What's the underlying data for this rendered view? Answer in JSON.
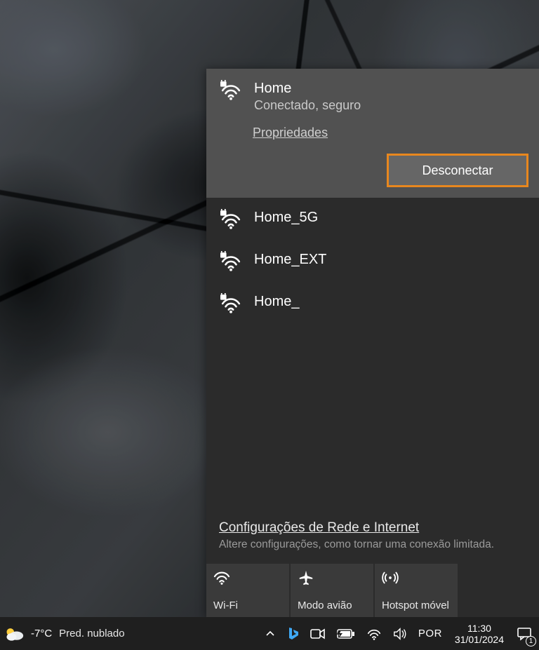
{
  "flyout": {
    "connected": {
      "ssid": "Home",
      "status": "Conectado, seguro",
      "properties_label": "Propriedades",
      "disconnect_label": "Desconectar"
    },
    "networks": [
      {
        "ssid": "Home_5G"
      },
      {
        "ssid": "Home_EXT"
      },
      {
        "ssid": "Home_"
      }
    ],
    "settings_link": {
      "title": "Configurações de Rede e Internet",
      "subtitle": "Altere configurações, como tornar uma conexão limitada."
    },
    "tiles": {
      "wifi": "Wi-Fi",
      "airplane": "Modo avião",
      "hotspot": "Hotspot móvel"
    }
  },
  "taskbar": {
    "weather": {
      "temp": "-7°C",
      "desc": "Pred. nublado"
    },
    "language": "POR",
    "time": "11:30",
    "date": "31/01/2024",
    "notification_count": "1"
  }
}
